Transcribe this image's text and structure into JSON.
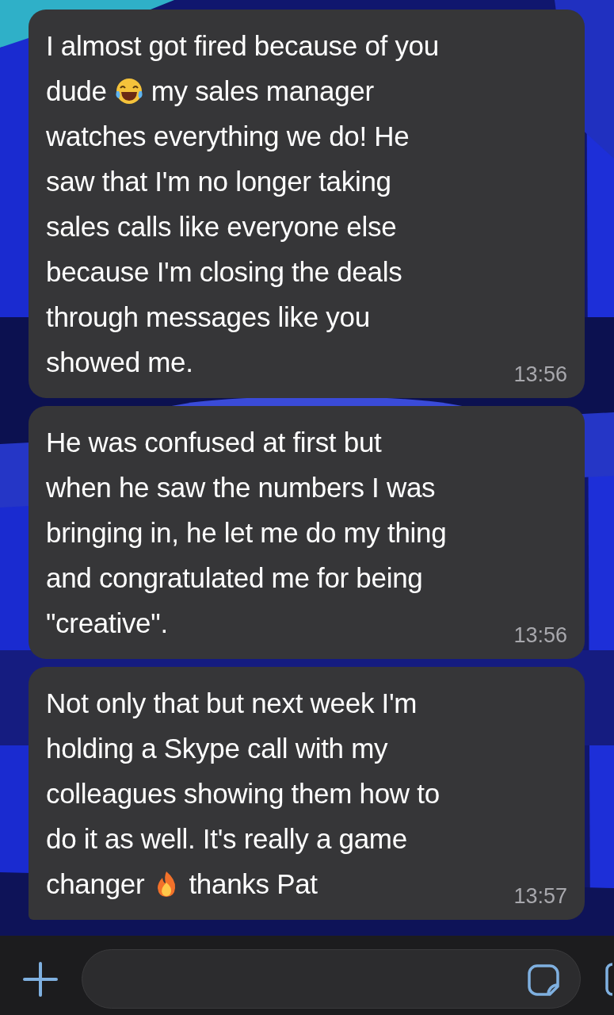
{
  "messages": [
    {
      "lines": [
        [
          {
            "kind": "text",
            "text": "I almost got fired because of you"
          }
        ],
        [
          {
            "kind": "text",
            "text": "dude"
          },
          {
            "kind": "laugh_emoji"
          },
          {
            "kind": "text",
            "text": "my sales manager"
          }
        ],
        [
          {
            "kind": "text",
            "text": "watches everything we do! He"
          }
        ],
        [
          {
            "kind": "text",
            "text": "saw that I'm no longer taking"
          }
        ],
        [
          {
            "kind": "text",
            "text": "sales calls like everyone else"
          }
        ],
        [
          {
            "kind": "text",
            "text": "because I'm closing the deals"
          }
        ],
        [
          {
            "kind": "text",
            "text": "through messages like you"
          }
        ],
        [
          {
            "kind": "text",
            "text": "showed me."
          }
        ]
      ],
      "time": "13:56",
      "tail": false
    },
    {
      "lines": [
        [
          {
            "kind": "text",
            "text": "He was confused at first but"
          }
        ],
        [
          {
            "kind": "text",
            "text": "when he saw the numbers I was"
          }
        ],
        [
          {
            "kind": "text",
            "text": "bringing in, he let me do my thing"
          }
        ],
        [
          {
            "kind": "text",
            "text": "and congratulated me for being"
          }
        ],
        [
          {
            "kind": "text",
            "text": "\"creative\"."
          }
        ]
      ],
      "time": "13:56",
      "tail": false
    },
    {
      "lines": [
        [
          {
            "kind": "text",
            "text": "Not only that but next week I'm"
          }
        ],
        [
          {
            "kind": "text",
            "text": "holding a Skype call with my"
          }
        ],
        [
          {
            "kind": "text",
            "text": "colleagues showing them how to"
          }
        ],
        [
          {
            "kind": "text",
            "text": "do it as well. It's really a game"
          }
        ],
        [
          {
            "kind": "text",
            "text": "changer"
          },
          {
            "kind": "fire_emoji"
          },
          {
            "kind": "text",
            "text": "thanks Pat"
          }
        ]
      ],
      "time": "13:57",
      "tail": true
    }
  ]
}
